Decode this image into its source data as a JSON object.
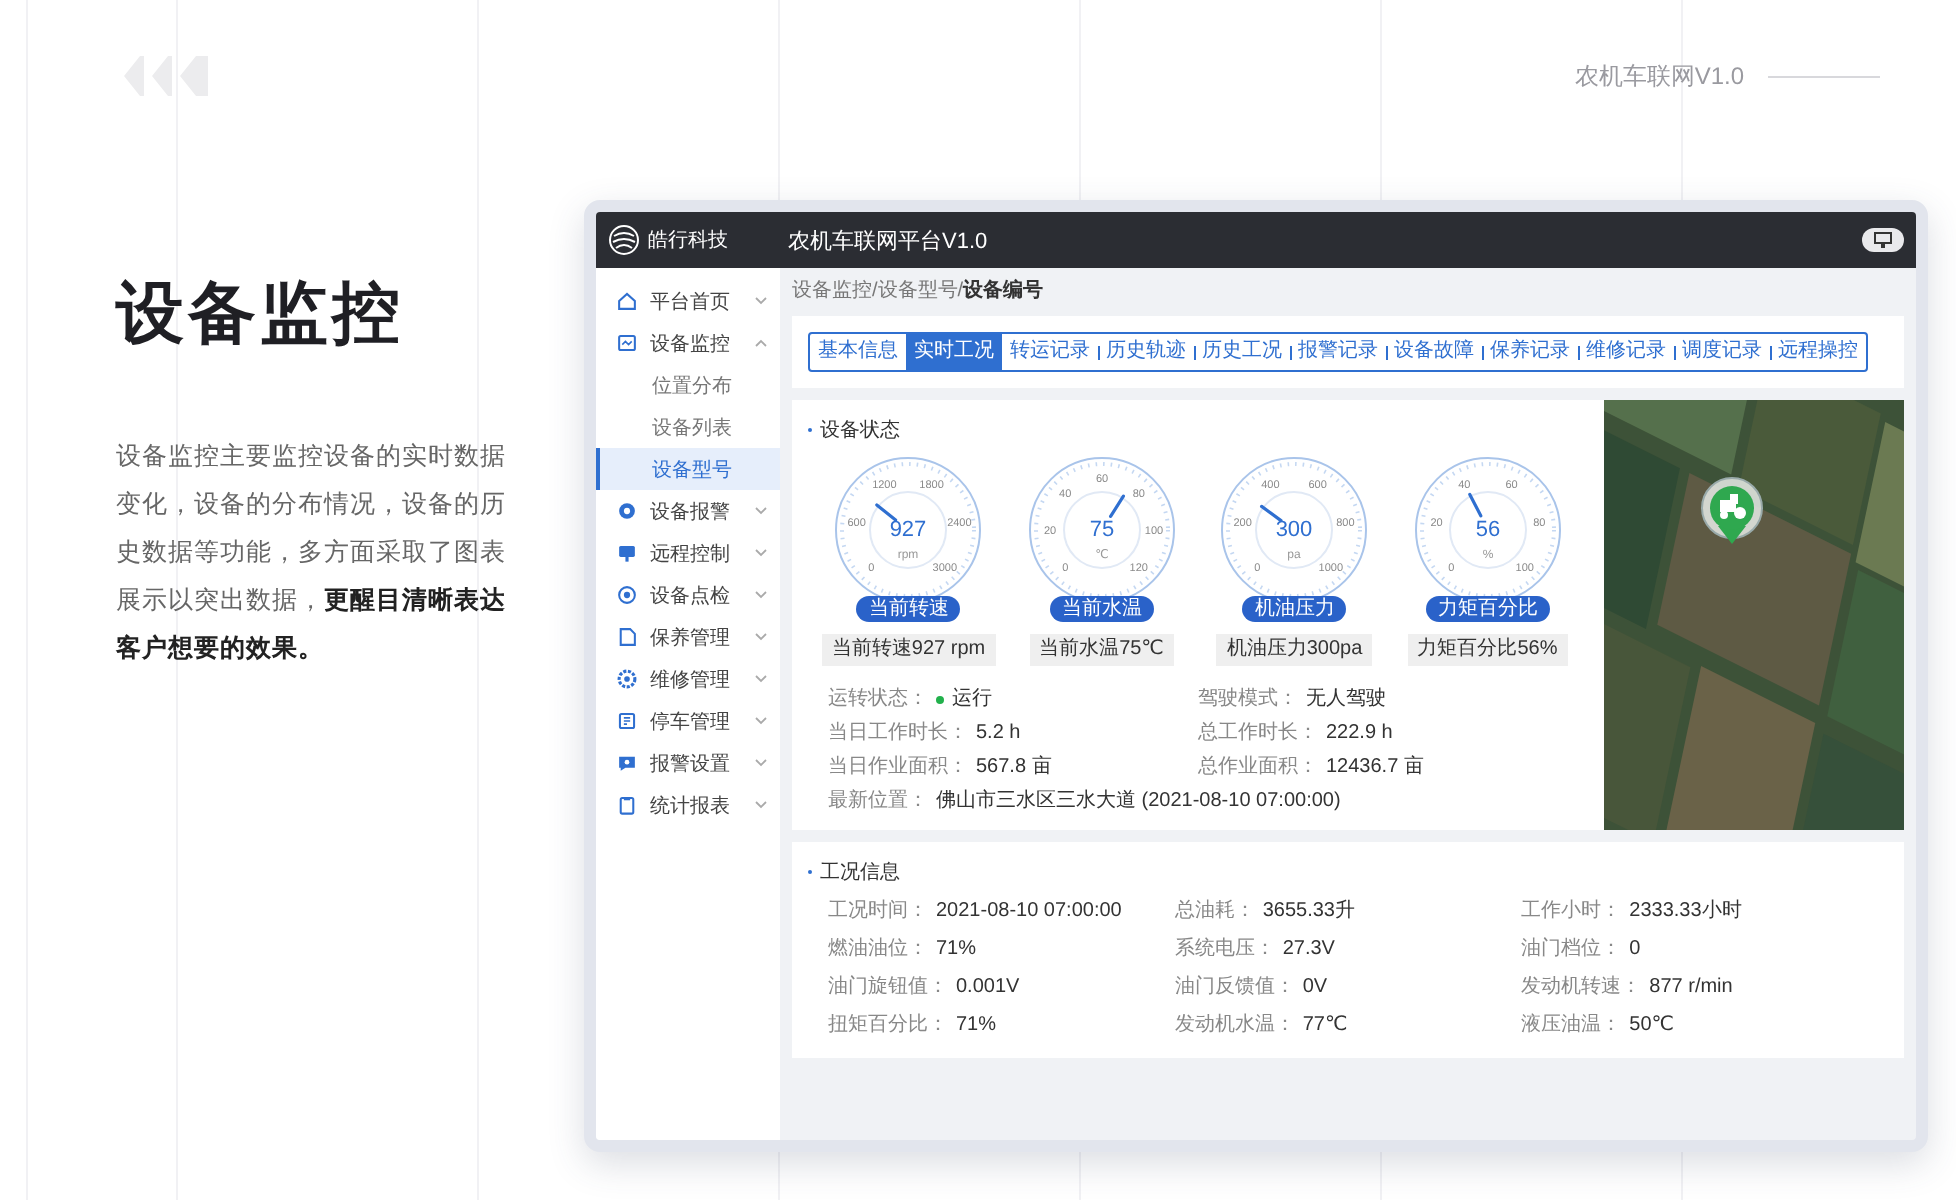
{
  "page": {
    "version": "农机车联网V1.0",
    "title": "设备监控",
    "description": "设备监控主要监控设备的实时数据变化，设备的分布情况，设备的历史数据等功能，多方面采取了图表展示以突出数据，**更醒目清晰表达客户想要的效果。**"
  },
  "app": {
    "logo_text": "皓行科技",
    "title": "农机车联网平台V1.0",
    "breadcrumb": "设备监控/设备型号/**设备编号**"
  },
  "sidebar": {
    "items": [
      {
        "label": "平台首页",
        "selected": false,
        "expanded": false
      },
      {
        "label": "设备监控",
        "selected": false,
        "expanded": true,
        "children": [
          {
            "label": "位置分布",
            "selected": false
          },
          {
            "label": "设备列表",
            "selected": false
          },
          {
            "label": "设备型号",
            "selected": true
          }
        ]
      },
      {
        "label": "设备报警",
        "selected": false,
        "expanded": false
      },
      {
        "label": "远程控制",
        "selected": false,
        "expanded": false
      },
      {
        "label": "设备点检",
        "selected": false,
        "expanded": false
      },
      {
        "label": "保养管理",
        "selected": false,
        "expanded": false
      },
      {
        "label": "维修管理",
        "selected": false,
        "expanded": false
      },
      {
        "label": "停车管理",
        "selected": false,
        "expanded": false
      },
      {
        "label": "报警设置",
        "selected": false,
        "expanded": false
      },
      {
        "label": "统计报表",
        "selected": false,
        "expanded": false
      }
    ]
  },
  "tabs": [
    {
      "label": "基本信息",
      "selected": false
    },
    {
      "label": "实时工况",
      "selected": true
    },
    {
      "label": "转运记录",
      "selected": false
    },
    {
      "label": "历史轨迹",
      "selected": false
    },
    {
      "label": "历史工况",
      "selected": false
    },
    {
      "label": "报警记录",
      "selected": false
    },
    {
      "label": "设备故障",
      "selected": false
    },
    {
      "label": "保养记录",
      "selected": false
    },
    {
      "label": "维修记录",
      "selected": false
    },
    {
      "label": "调度记录",
      "selected": false
    },
    {
      "label": "远程操控",
      "selected": false
    }
  ],
  "status": {
    "title": "设备状态",
    "gauges": [
      {
        "value": "927",
        "unit": "rpm",
        "badge": "当前转速",
        "caption": "当前转速927 rpm",
        "level": 0.31,
        "ticks": [
          "0",
          "600",
          "1200",
          "1800",
          "2400",
          "3000"
        ]
      },
      {
        "value": "75",
        "unit": "℃",
        "badge": "当前水温",
        "caption": "当前水温75℃",
        "level": 0.62,
        "ticks": [
          "0",
          "20",
          "40",
          "60",
          "80",
          "100",
          "120"
        ]
      },
      {
        "value": "300",
        "unit": "pa",
        "badge": "机油压力",
        "caption": "机油压力300pa",
        "level": 0.3,
        "ticks": [
          "0",
          "200",
          "400",
          "600",
          "800",
          "1000"
        ]
      },
      {
        "value": "56",
        "unit": "%",
        "badge": "力矩百分比",
        "caption": "力矩百分比56%",
        "level": 0.4,
        "ticks": [
          "0",
          "20",
          "40",
          "60",
          "80",
          "100"
        ]
      }
    ],
    "fields": [
      {
        "label": "运转状态：",
        "value": "运行",
        "color": "#22b14c"
      },
      {
        "label": "驾驶模式：",
        "value": "无人驾驶"
      },
      {
        "label": "当日工作时长：",
        "value": "5.2 h"
      },
      {
        "label": "总工作时长：",
        "value": "222.9 h"
      },
      {
        "label": "当日作业面积：",
        "value": "567.8 亩"
      },
      {
        "label": "总作业面积：",
        "value": "12436.7 亩"
      },
      {
        "label": "最新位置：",
        "value": "佛山市三水区三水大道 (2021-08-10 07:00:00)",
        "kind": "wide"
      }
    ]
  },
  "work": {
    "title": "工况信息",
    "fields": [
      {
        "label": "工况时间：",
        "value": "2021-08-10 07:00:00"
      },
      {
        "label": "总油耗：",
        "value": "3655.33升"
      },
      {
        "label": "工作小时：",
        "value": "2333.33小时"
      },
      {
        "label": "燃油油位：",
        "value": "71%"
      },
      {
        "label": "系统电压：",
        "value": "27.3V"
      },
      {
        "label": "油门档位：",
        "value": "0"
      },
      {
        "label": "油门旋钮值：",
        "value": "0.001V"
      },
      {
        "label": "油门反馈值：",
        "value": "0V"
      },
      {
        "label": "发动机转速：",
        "value": "877 r/min"
      },
      {
        "label": "扭矩百分比：",
        "value": "71%"
      },
      {
        "label": "发动机水温：",
        "value": "77℃"
      },
      {
        "label": "液压油温：",
        "value": "50℃"
      }
    ]
  }
}
